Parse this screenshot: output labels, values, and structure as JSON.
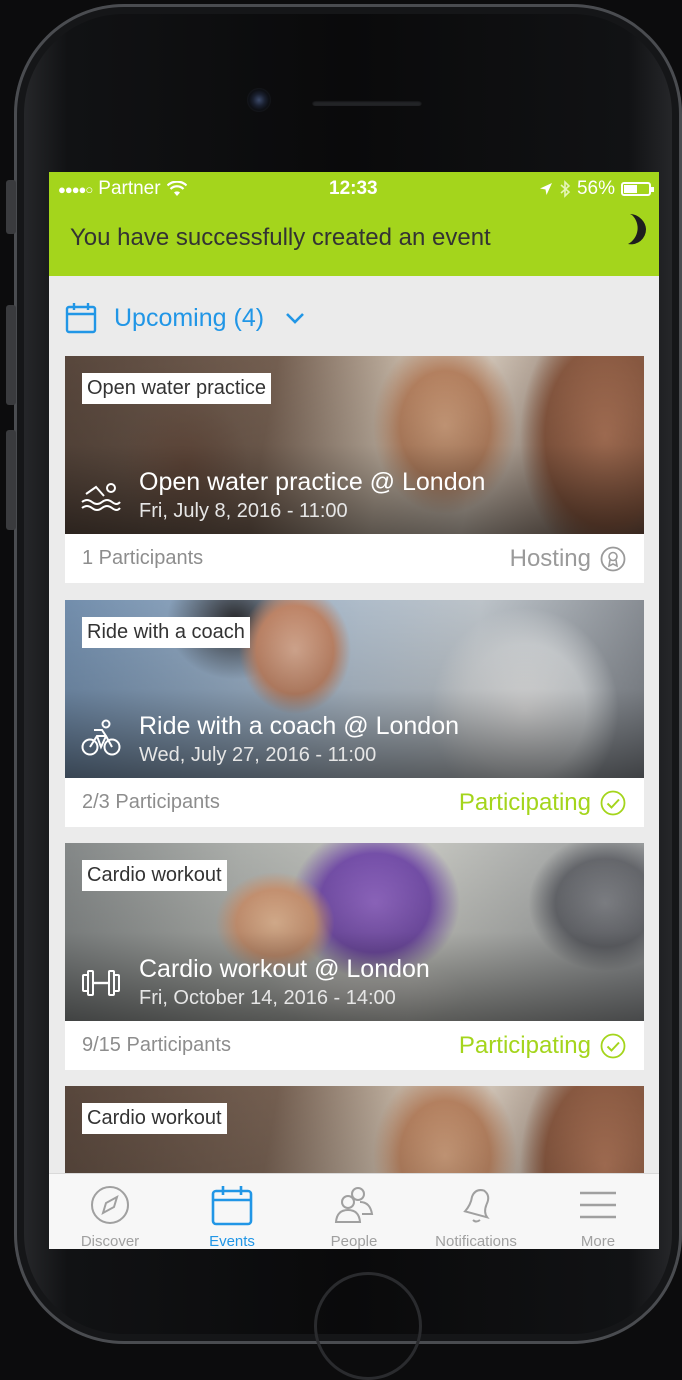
{
  "status_bar": {
    "signal": "●●●●○",
    "carrier": "Partner",
    "wifi_icon": "wifi-icon",
    "time": "12:33",
    "battery": "56%"
  },
  "banner": {
    "message": "You have successfully created an event"
  },
  "filter": {
    "label": "Upcoming (4)"
  },
  "events": [
    {
      "tag": "Open water practice",
      "sport_icon": "swimming-icon",
      "title": "Open water practice @ London",
      "date": "Fri, July 8, 2016 - 11:00",
      "participants": "1 Participants",
      "status": "Hosting",
      "status_type": "hosting"
    },
    {
      "tag": "Ride with a coach",
      "sport_icon": "cycling-icon",
      "title": "Ride with a coach @ London",
      "date": "Wed, July 27, 2016 - 11:00",
      "participants": "2/3 Participants",
      "status": "Participating",
      "status_type": "participating"
    },
    {
      "tag": "Cardio workout",
      "sport_icon": "dumbbell-icon",
      "title": "Cardio workout @ London",
      "date": "Fri, October 14, 2016 - 14:00",
      "participants": "9/15 Participants",
      "status": "Participating",
      "status_type": "participating"
    },
    {
      "tag": "Cardio workout"
    }
  ],
  "tabs": [
    {
      "label": "Discover",
      "icon": "compass-icon"
    },
    {
      "label": "Events",
      "icon": "calendar-icon",
      "active": true
    },
    {
      "label": "People",
      "icon": "people-icon"
    },
    {
      "label": "Notifications",
      "icon": "bell-icon"
    },
    {
      "label": "More",
      "icon": "menu-icon"
    }
  ],
  "colors": {
    "accent_green": "#a4d51c",
    "accent_blue": "#2196e6"
  }
}
